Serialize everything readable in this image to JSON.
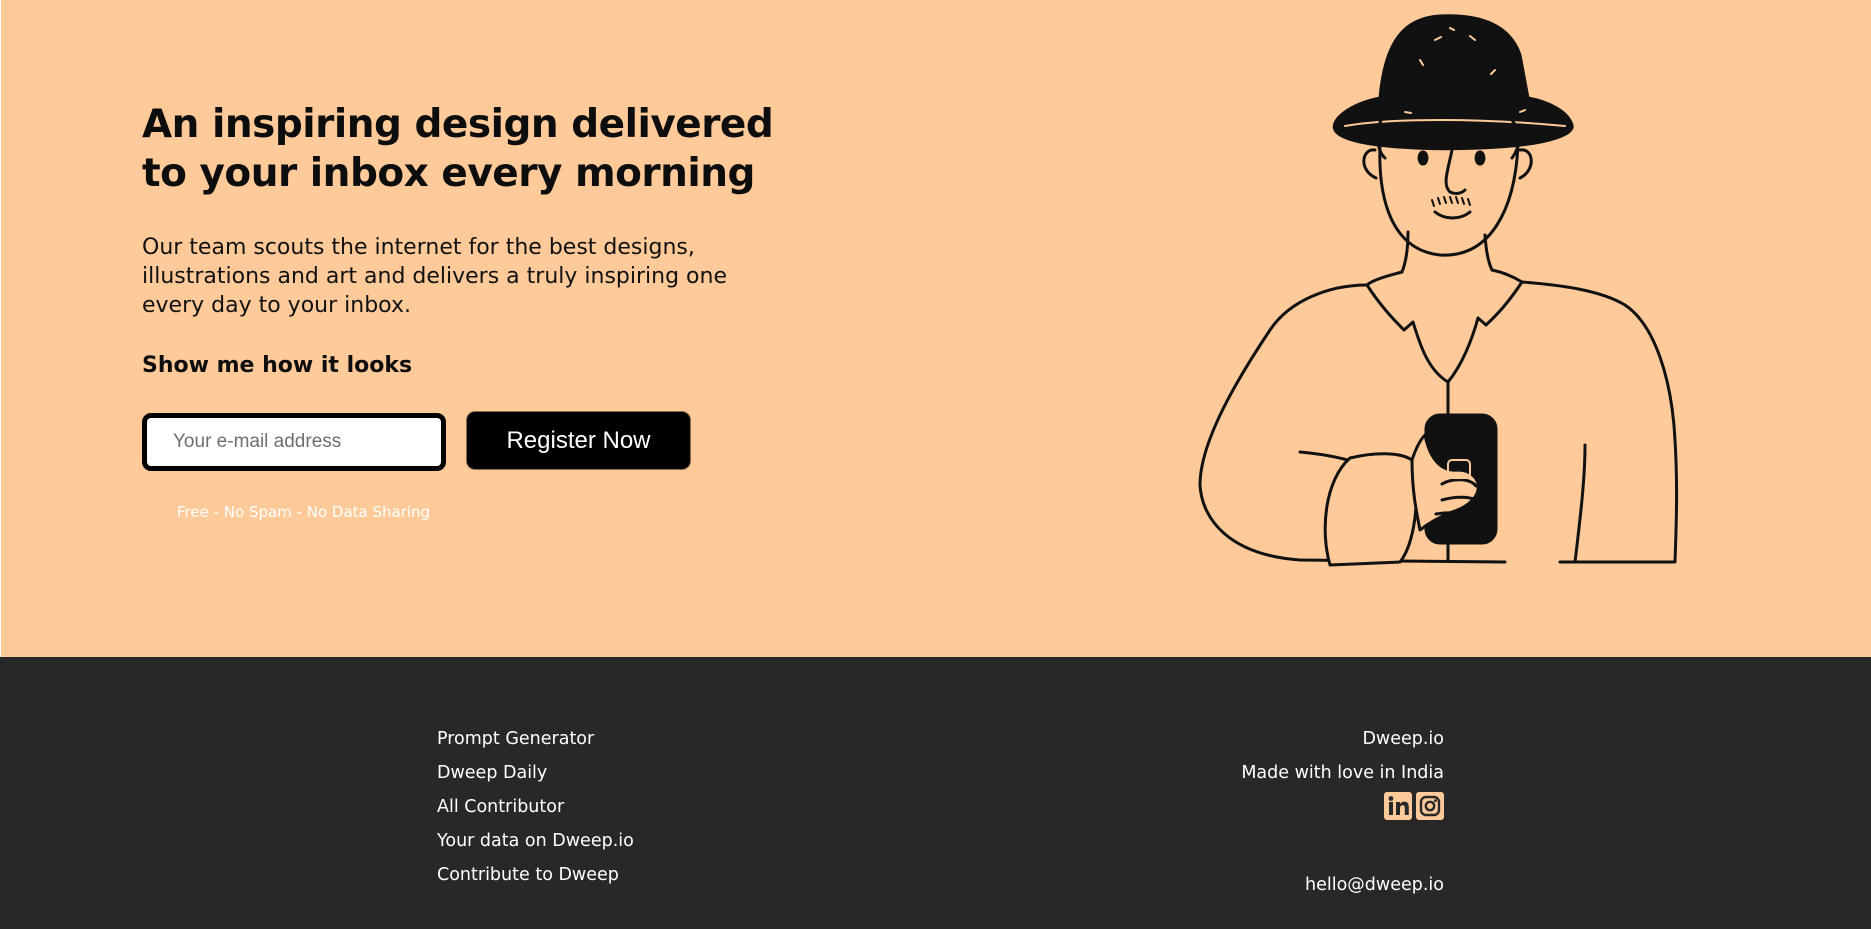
{
  "hero": {
    "headline": "An inspiring design delivered to your inbox every morning",
    "description": "Our team scouts the internet for the best designs, illustrations and art and delivers a truly inspiring one every day to your inbox.",
    "cta_heading": "Show me how it looks",
    "email_placeholder": "Your e-mail address",
    "register_label": "Register Now",
    "disclaimer": "Free - No Spam - No Data Sharing",
    "background_color": "#FFCA99"
  },
  "illustration": {
    "subject": "man-with-hat-holding-phone"
  },
  "footer": {
    "background_color": "#282828",
    "links": [
      "Prompt Generator",
      "Dweep Daily",
      "All Contributor",
      "Your data on Dweep.io",
      "Contribute to Dweep"
    ],
    "brand": "Dweep.io",
    "tagline": "Made with love in India",
    "social": [
      "linkedin-icon",
      "instagram-icon"
    ],
    "email": "hello@dweep.io"
  }
}
